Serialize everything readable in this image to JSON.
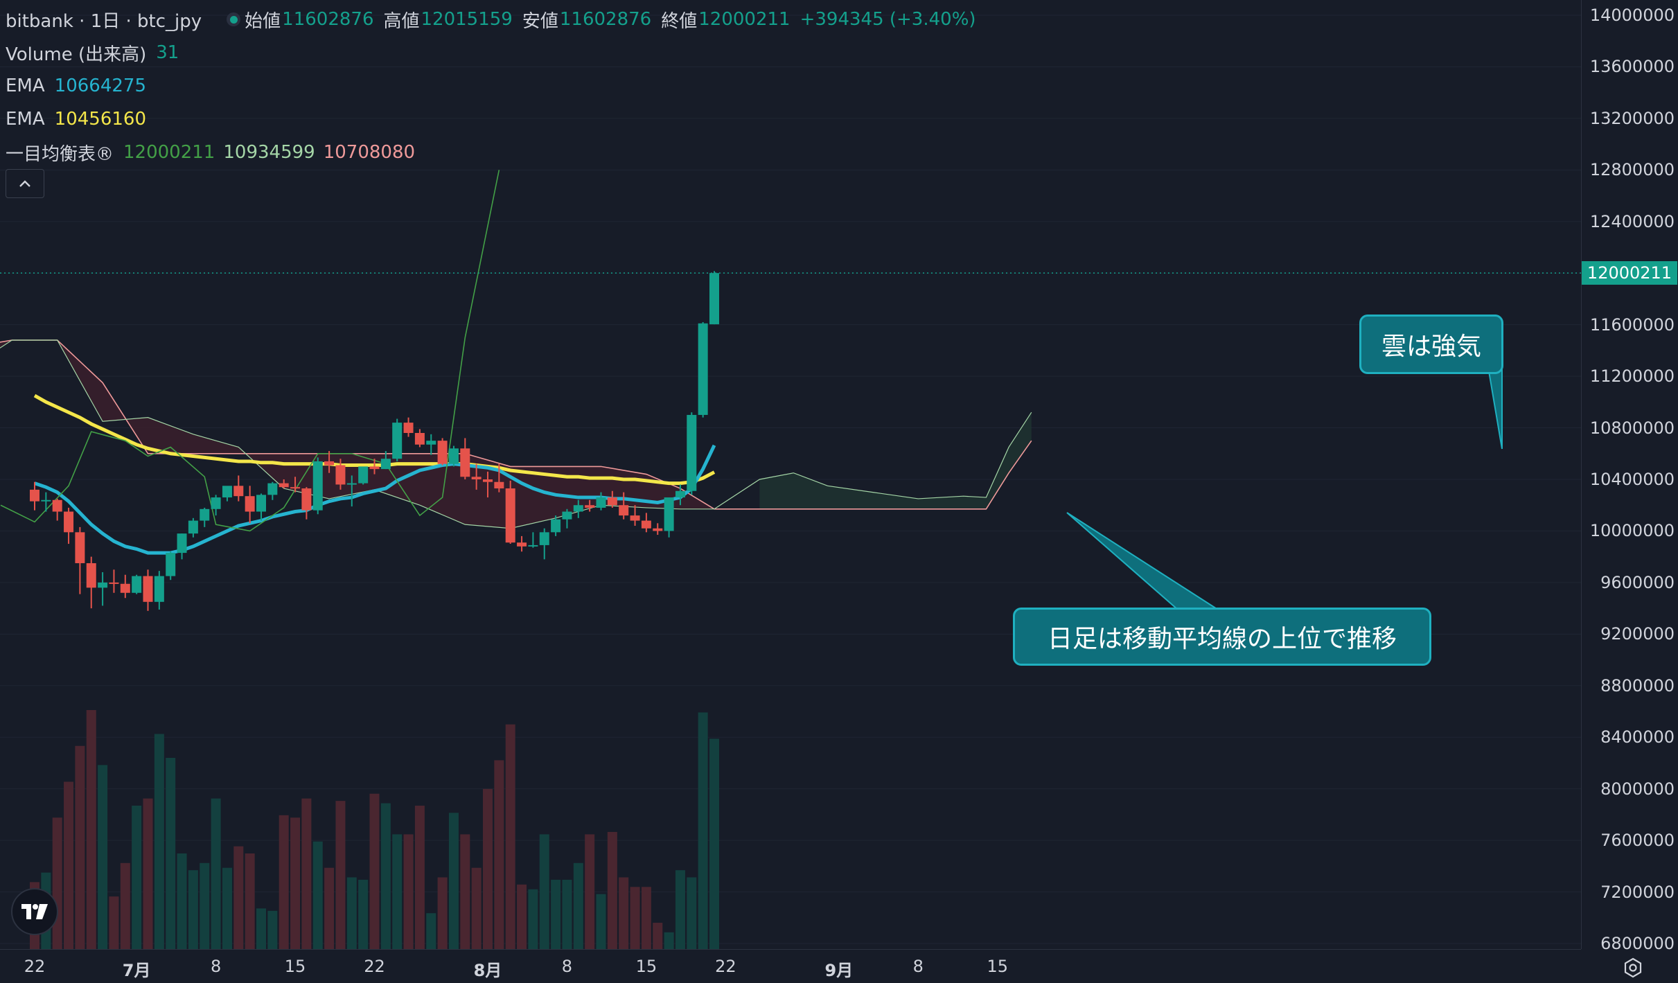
{
  "header": {
    "symbol": "bitbank · 1日 · btc_jpy",
    "ohlc": [
      {
        "label": "始値",
        "value": "11602876"
      },
      {
        "label": "高値",
        "value": "12015159"
      },
      {
        "label": "安値",
        "value": "11602876"
      },
      {
        "label": "終値",
        "value": "12000211"
      }
    ],
    "change": "+394345 (+3.40%)"
  },
  "indicators": {
    "volume": {
      "label": "Volume (出来高)",
      "value": "31"
    },
    "ema1": {
      "label": "EMA",
      "value": "10664275",
      "color": "#26b4d0"
    },
    "ema2": {
      "label": "EMA",
      "value": "10456160",
      "color": "#f4e64a"
    },
    "ichimoku": {
      "label": "一目均衡表®",
      "values": [
        "12000211",
        "10934599",
        "10708080"
      ],
      "colors": [
        "#43a047",
        "#a5d6a7",
        "#ef9a9a"
      ]
    }
  },
  "colors": {
    "up": "#14a08c",
    "down": "#e5534b",
    "background": "#171c28"
  },
  "price_axis": {
    "ticks": [
      "14000000",
      "13600000",
      "13200000",
      "12800000",
      "12400000",
      "12000000",
      "11600000",
      "11200000",
      "10800000",
      "10400000",
      "10000000",
      "9600000",
      "9200000",
      "8800000",
      "8400000",
      "8000000",
      "7600000",
      "7200000",
      "6800000"
    ],
    "current_price": "12000211"
  },
  "time_axis": {
    "ticks": [
      {
        "label": "22",
        "month": false
      },
      {
        "label": "7月",
        "month": true
      },
      {
        "label": "8",
        "month": false
      },
      {
        "label": "15",
        "month": false
      },
      {
        "label": "22",
        "month": false
      },
      {
        "label": "8月",
        "month": true
      },
      {
        "label": "8",
        "month": false
      },
      {
        "label": "15",
        "month": false
      },
      {
        "label": "22",
        "month": false
      },
      {
        "label": "9月",
        "month": true
      },
      {
        "label": "8",
        "month": false
      },
      {
        "label": "15",
        "month": false
      }
    ]
  },
  "annotations": {
    "cloud_note": "雲は強気",
    "daily_note": "日足は移動平均線の上位で推移"
  },
  "chart_data": {
    "type": "candlestick",
    "dates": [
      "6/22",
      "6/23",
      "6/24",
      "6/25",
      "6/26",
      "6/27",
      "6/28",
      "6/29",
      "6/30",
      "7/1",
      "7/2",
      "7/3",
      "7/4",
      "7/5",
      "7/6",
      "7/7",
      "7/8",
      "7/9",
      "7/10",
      "7/11",
      "7/12",
      "7/13",
      "7/14",
      "7/15",
      "7/16",
      "7/17",
      "7/18",
      "7/19",
      "7/20",
      "7/21",
      "7/22",
      "7/23",
      "7/24",
      "7/25",
      "7/26",
      "7/27",
      "7/28",
      "7/29",
      "7/30",
      "7/31",
      "8/1",
      "8/2",
      "8/3",
      "8/4",
      "8/5",
      "8/6",
      "8/7",
      "8/8",
      "8/9",
      "8/10",
      "8/11",
      "8/12",
      "8/13",
      "8/14",
      "8/15",
      "8/16",
      "8/17",
      "8/18",
      "8/19",
      "8/20",
      "8/21"
    ],
    "ohlc": [
      [
        10320000,
        10380000,
        10160000,
        10230000
      ],
      [
        10230000,
        10300000,
        10150000,
        10240000
      ],
      [
        10240000,
        10250000,
        10080000,
        10150000
      ],
      [
        10150000,
        10180000,
        9900000,
        9990000
      ],
      [
        9990000,
        10030000,
        9510000,
        9750000
      ],
      [
        9750000,
        9800000,
        9400000,
        9560000
      ],
      [
        9560000,
        9680000,
        9420000,
        9600000
      ],
      [
        9600000,
        9700000,
        9520000,
        9590000
      ],
      [
        9590000,
        9660000,
        9480000,
        9520000
      ],
      [
        9520000,
        9660000,
        9510000,
        9650000
      ],
      [
        9650000,
        9700000,
        9380000,
        9450000
      ],
      [
        9450000,
        9690000,
        9390000,
        9650000
      ],
      [
        9650000,
        9840000,
        9620000,
        9830000
      ],
      [
        9830000,
        9980000,
        9780000,
        9980000
      ],
      [
        9980000,
        10100000,
        9950000,
        10080000
      ],
      [
        10080000,
        10180000,
        10030000,
        10170000
      ],
      [
        10170000,
        10280000,
        10120000,
        10260000
      ],
      [
        10260000,
        10340000,
        10230000,
        10350000
      ],
      [
        10350000,
        10430000,
        10230000,
        10270000
      ],
      [
        10270000,
        10350000,
        10060000,
        10150000
      ],
      [
        10150000,
        10290000,
        10080000,
        10280000
      ],
      [
        10280000,
        10380000,
        10240000,
        10370000
      ],
      [
        10370000,
        10400000,
        10330000,
        10340000
      ],
      [
        10340000,
        10420000,
        10300000,
        10330000
      ],
      [
        10330000,
        10340000,
        10090000,
        10160000
      ],
      [
        10160000,
        10570000,
        10130000,
        10540000
      ],
      [
        10540000,
        10620000,
        10450000,
        10510000
      ],
      [
        10510000,
        10560000,
        10320000,
        10360000
      ],
      [
        10360000,
        10430000,
        10190000,
        10370000
      ],
      [
        10370000,
        10440000,
        10360000,
        10500000
      ],
      [
        10500000,
        10560000,
        10440000,
        10480000
      ],
      [
        10480000,
        10620000,
        10480000,
        10560000
      ],
      [
        10560000,
        10870000,
        10540000,
        10840000
      ],
      [
        10840000,
        10880000,
        10730000,
        10760000
      ],
      [
        10760000,
        10790000,
        10650000,
        10670000
      ],
      [
        10670000,
        10750000,
        10590000,
        10700000
      ],
      [
        10700000,
        10720000,
        10510000,
        10520000
      ],
      [
        10520000,
        10660000,
        10500000,
        10640000
      ],
      [
        10640000,
        10720000,
        10400000,
        10420000
      ],
      [
        10420000,
        10520000,
        10320000,
        10400000
      ],
      [
        10400000,
        10460000,
        10260000,
        10380000
      ],
      [
        10380000,
        10520000,
        10300000,
        10330000
      ],
      [
        10330000,
        10390000,
        9900000,
        9910000
      ],
      [
        9910000,
        9960000,
        9840000,
        9880000
      ],
      [
        9880000,
        9990000,
        9870000,
        9890000
      ],
      [
        9890000,
        10020000,
        9780000,
        9990000
      ],
      [
        9990000,
        10120000,
        9960000,
        10090000
      ],
      [
        10090000,
        10170000,
        10020000,
        10150000
      ],
      [
        10150000,
        10240000,
        10100000,
        10200000
      ],
      [
        10200000,
        10240000,
        10150000,
        10180000
      ],
      [
        10180000,
        10300000,
        10160000,
        10260000
      ],
      [
        10260000,
        10310000,
        10180000,
        10200000
      ],
      [
        10200000,
        10300000,
        10090000,
        10120000
      ],
      [
        10120000,
        10200000,
        10040000,
        10080000
      ],
      [
        10080000,
        10140000,
        9990000,
        10020000
      ],
      [
        10020000,
        10060000,
        9970000,
        10000000
      ],
      [
        10000000,
        10100000,
        9950000,
        10260000
      ],
      [
        10260000,
        10360000,
        10200000,
        10310000
      ],
      [
        10310000,
        10920000,
        10280000,
        10900000
      ],
      [
        10900000,
        11620000,
        10880000,
        11610000
      ],
      [
        11602876,
        12015159,
        11602876,
        12000211
      ]
    ],
    "volume_scale_note": "",
    "volume": [
      0.28,
      0.32,
      0.55,
      0.7,
      0.85,
      1.0,
      0.77,
      0.22,
      0.36,
      0.6,
      0.63,
      0.9,
      0.8,
      0.4,
      0.33,
      0.36,
      0.63,
      0.34,
      0.43,
      0.4,
      0.17,
      0.16,
      0.56,
      0.55,
      0.63,
      0.45,
      0.34,
      0.62,
      0.3,
      0.29,
      0.65,
      0.61,
      0.48,
      0.48,
      0.6,
      0.15,
      0.3,
      0.57,
      0.48,
      0.34,
      0.67,
      0.79,
      0.94,
      0.27,
      0.25,
      0.48,
      0.29,
      0.29,
      0.36,
      0.48,
      0.23,
      0.49,
      0.3,
      0.26,
      0.26,
      0.11,
      0.07,
      0.33,
      0.3,
      0.99,
      0.88
    ],
    "ema_fast": {
      "name": "EMA",
      "values": [
        10370000,
        10340000,
        10300000,
        10230000,
        10140000,
        10050000,
        9980000,
        9920000,
        9880000,
        9860000,
        9830000,
        9830000,
        9830000,
        9850000,
        9880000,
        9920000,
        9960000,
        10000000,
        10040000,
        10060000,
        10080000,
        10110000,
        10130000,
        10150000,
        10160000,
        10200000,
        10230000,
        10250000,
        10260000,
        10290000,
        10310000,
        10330000,
        10390000,
        10430000,
        10470000,
        10490000,
        10510000,
        10520000,
        10510000,
        10500000,
        10490000,
        10470000,
        10420000,
        10370000,
        10330000,
        10300000,
        10280000,
        10270000,
        10260000,
        10260000,
        10260000,
        10250000,
        10250000,
        10240000,
        10230000,
        10220000,
        10240000,
        10260000,
        10330000,
        10480000,
        10664275
      ]
    },
    "ema_slow": {
      "name": "EMA",
      "values": [
        11050000,
        11000000,
        10960000,
        10920000,
        10880000,
        10830000,
        10790000,
        10750000,
        10710000,
        10670000,
        10640000,
        10620000,
        10600000,
        10590000,
        10580000,
        10570000,
        10560000,
        10550000,
        10540000,
        10540000,
        10530000,
        10530000,
        10520000,
        10520000,
        10520000,
        10520000,
        10520000,
        10510000,
        10510000,
        10510000,
        10510000,
        10510000,
        10520000,
        10520000,
        10520000,
        10520000,
        10520000,
        10520000,
        10520000,
        10510000,
        10500000,
        10490000,
        10470000,
        10460000,
        10450000,
        10440000,
        10430000,
        10420000,
        10420000,
        10410000,
        10410000,
        10410000,
        10400000,
        10400000,
        10390000,
        10380000,
        10370000,
        10370000,
        10380000,
        10410000,
        10456160
      ]
    },
    "ichimoku": {
      "name": "一目均衡表®",
      "tenkan": "12000211",
      "kijun": "10934599",
      "senkou": "10708080"
    }
  }
}
